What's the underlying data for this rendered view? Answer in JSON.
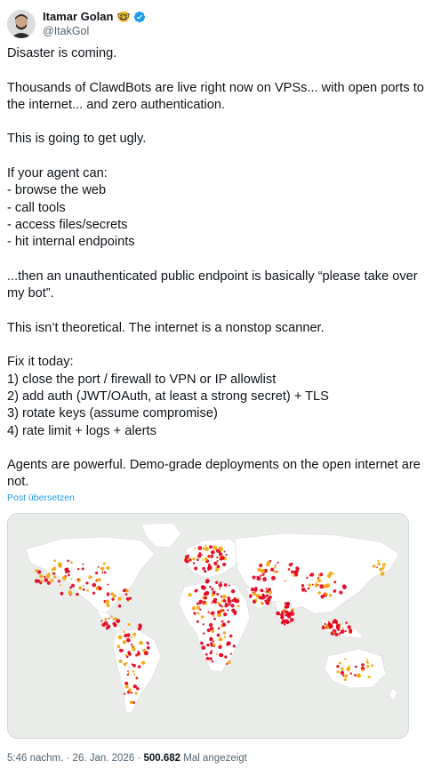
{
  "author": {
    "display_name": "Itamar Golan",
    "badge_emoji": "🤓",
    "handle": "@ItakGol",
    "avatar_icon": "avatar-photo",
    "verified_icon": "verified-badge-icon",
    "verified_color": "#1d9bf0"
  },
  "tweet": {
    "paragraphs": [
      {
        "lines": [
          "Disaster is coming."
        ]
      },
      {
        "lines": [
          "Thousands of ClawdBots are live right now on VPSs... with open ports to",
          "the internet... and zero authentication."
        ]
      },
      {
        "lines": [
          "This is going to get ugly."
        ]
      },
      {
        "lines": [
          "If your agent can:",
          "- browse the web",
          "- call tools",
          "- access files/secrets",
          "- hit internal endpoints"
        ]
      },
      {
        "lines": [
          "...then an unauthenticated public endpoint is basically “please take over",
          "my bot”."
        ]
      },
      {
        "lines": [
          "This isn’t theoretical. The internet is a nonstop scanner."
        ]
      },
      {
        "lines": [
          "Fix it today:",
          "1) close the port / firewall to VPN or IP allowlist",
          "2) add auth (JWT/OAuth, at least a strong secret) + TLS",
          "3) rotate keys (assume compromise)",
          "4) rate limit + logs + alerts"
        ]
      },
      {
        "lines": [
          "Agents are powerful. Demo-grade deployments on the open internet are",
          "not."
        ]
      }
    ]
  },
  "translate_link": "Post übersetzen",
  "media": {
    "type": "world-map-heatmap",
    "land_color": "#ffffff",
    "water_color": "#e9ece9",
    "hot_color": "#e3001b",
    "warm_color": "#f5a300"
  },
  "footer": {
    "time": "5:46 nachm.",
    "separator": "·",
    "date": "26. Jan. 2026",
    "views_count": "500.682",
    "views_label": "Mal angezeigt"
  }
}
